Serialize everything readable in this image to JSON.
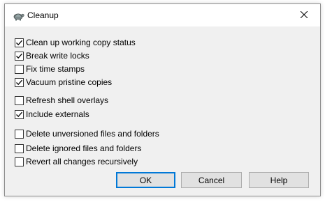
{
  "window": {
    "title": "Cleanup",
    "icon": "tortoise-icon",
    "close_icon": "close-icon"
  },
  "options": [
    {
      "label": "Clean up working copy status",
      "checked": true
    },
    {
      "label": "Break write locks",
      "checked": true
    },
    {
      "label": "Fix time stamps",
      "checked": false
    },
    {
      "label": "Vacuum pristine copies",
      "checked": true
    },
    {
      "label": "Refresh shell overlays",
      "checked": false
    },
    {
      "label": "Include externals",
      "checked": true
    },
    {
      "label": "Delete unversioned files and folders",
      "checked": false
    },
    {
      "label": "Delete ignored files and folders",
      "checked": false
    },
    {
      "label": "Revert all changes recursively",
      "checked": false
    }
  ],
  "buttons": {
    "ok": "OK",
    "cancel": "Cancel",
    "help": "Help"
  },
  "colors": {
    "accent": "#0078d7",
    "check": "#000000",
    "dialog_bg": "#f0f0f0",
    "titlebar_bg": "#ffffff"
  }
}
